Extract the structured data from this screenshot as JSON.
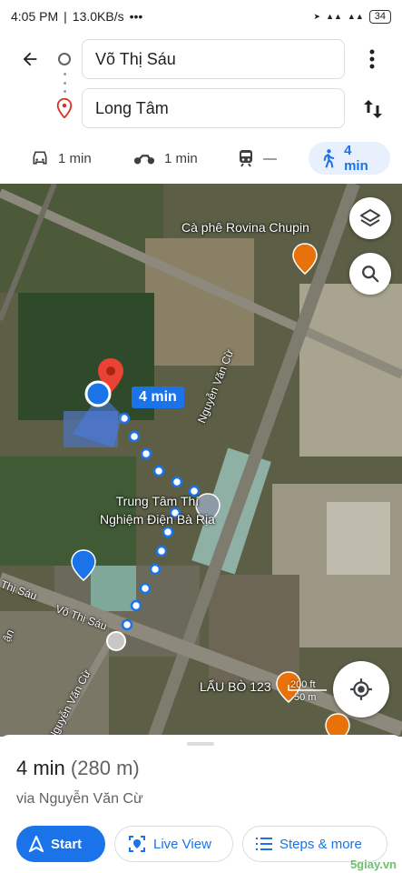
{
  "status": {
    "time": "4:05 PM",
    "speed": "13.0KB/s",
    "battery": "34"
  },
  "route": {
    "from": "Võ Thị Sáu",
    "to": "Long Tâm",
    "modes": [
      {
        "name": "car",
        "time": "1 min"
      },
      {
        "name": "motorcycle",
        "time": "1 min"
      },
      {
        "name": "transit",
        "time": "—"
      },
      {
        "name": "walk",
        "time": "4 min"
      }
    ]
  },
  "map": {
    "place_cafe": "Cà phê Rovina Chupin",
    "place_center": "Trung Tâm Thí\nNghiệm Điện Bà Rịa",
    "place_lau": "LẨU BÒ 123",
    "road_nvc": "Nguyễn Văn Cừ",
    "road_vts": "Võ Thị Sáu",
    "road_nvc2": "Nguyễn Văn Cừ",
    "road_vts2": "Thị Sáu",
    "road_edge": "ận",
    "eta": "4 min",
    "scale_ft": "200 ft",
    "scale_m": "50 m"
  },
  "sheet": {
    "duration": "4 min",
    "distance": "(280 m)",
    "via": "via Nguyễn Văn Cừ",
    "start": "Start",
    "live_view": "Live View",
    "steps": "Steps & more"
  },
  "watermark": "5giay.vn"
}
